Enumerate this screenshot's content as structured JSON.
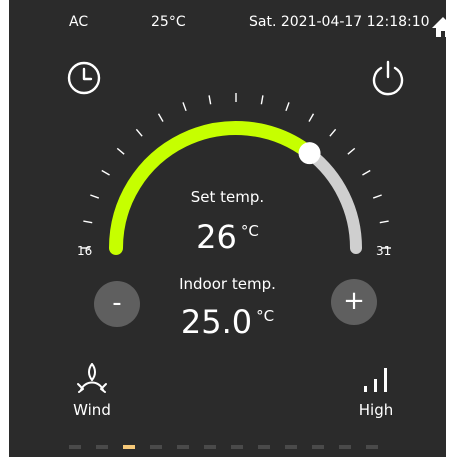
{
  "status_bar": {
    "mode": "AC",
    "outdoor_temp": "25°C",
    "datetime": "Sat. 2021-04-17 12:18:10"
  },
  "icons": {
    "timer": "clock-icon",
    "power": "power-icon",
    "home": "home-icon",
    "wind": "wind-swing-icon",
    "fan_speed": "signal-bars-icon"
  },
  "dial": {
    "min_label": "16",
    "max_label": "31",
    "min": 16,
    "max": 31,
    "setpoint_fraction": 0.71,
    "active_color": "#c6ff00",
    "inactive_color": "#cfcfcf"
  },
  "set_temp": {
    "label": "Set temp.",
    "value": "26",
    "unit": "°C"
  },
  "indoor_temp": {
    "label": "Indoor temp.",
    "value": "25.0",
    "unit": "°C"
  },
  "buttons": {
    "minus": "-",
    "plus": "+"
  },
  "wind": {
    "label": "Wind"
  },
  "fan": {
    "label": "High"
  },
  "pager": {
    "count": 12,
    "active_index": 2,
    "active_color": "#f5c878"
  }
}
